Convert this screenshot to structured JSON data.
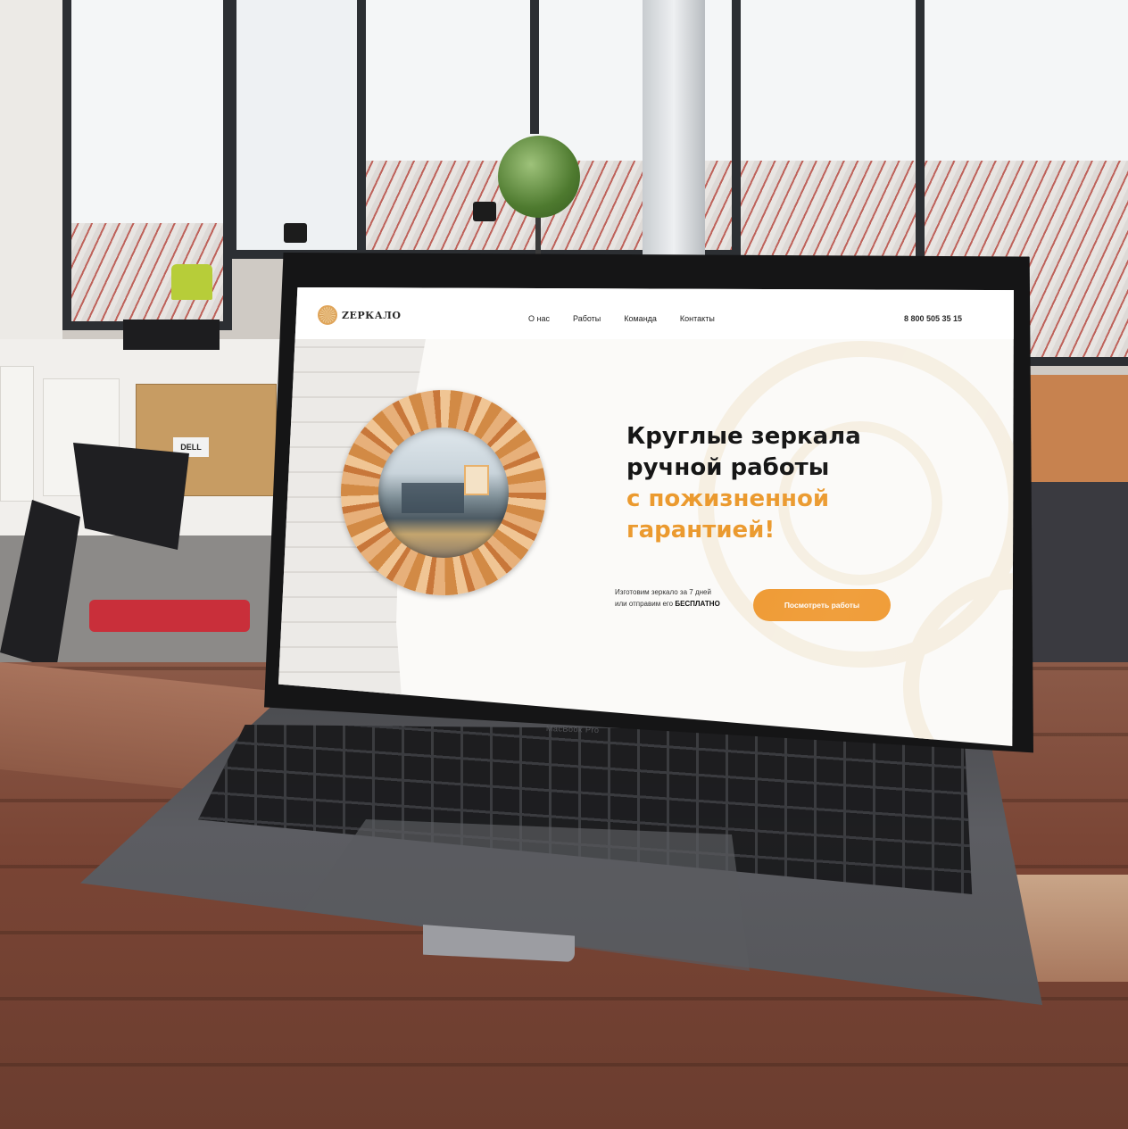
{
  "site": {
    "logo_text": "ZЕРКАЛО",
    "nav": [
      "О нас",
      "Работы",
      "Команда",
      "Контакты"
    ],
    "phone": "8 800 505 35 15",
    "hero": {
      "title_line1": "Круглые зеркала",
      "title_line2": "ручной работы",
      "title_line3": "с пожизненной",
      "title_line4": "гарантией!"
    },
    "subtitle_line1": "Изготовим зеркало за 7 дней",
    "subtitle_line2_prefix": "или отправим его",
    "subtitle_line2_bold": "БЕСПЛАТНО",
    "cta_label": "Посмотреть работы",
    "colors": {
      "accent": "#eb9a2f",
      "button": "#ef9a33",
      "text": "#161616",
      "background": "#fbfaf8"
    }
  },
  "laptop": {
    "brand_text": "MacBook Pro"
  },
  "background": {
    "box_label": "DELL"
  }
}
